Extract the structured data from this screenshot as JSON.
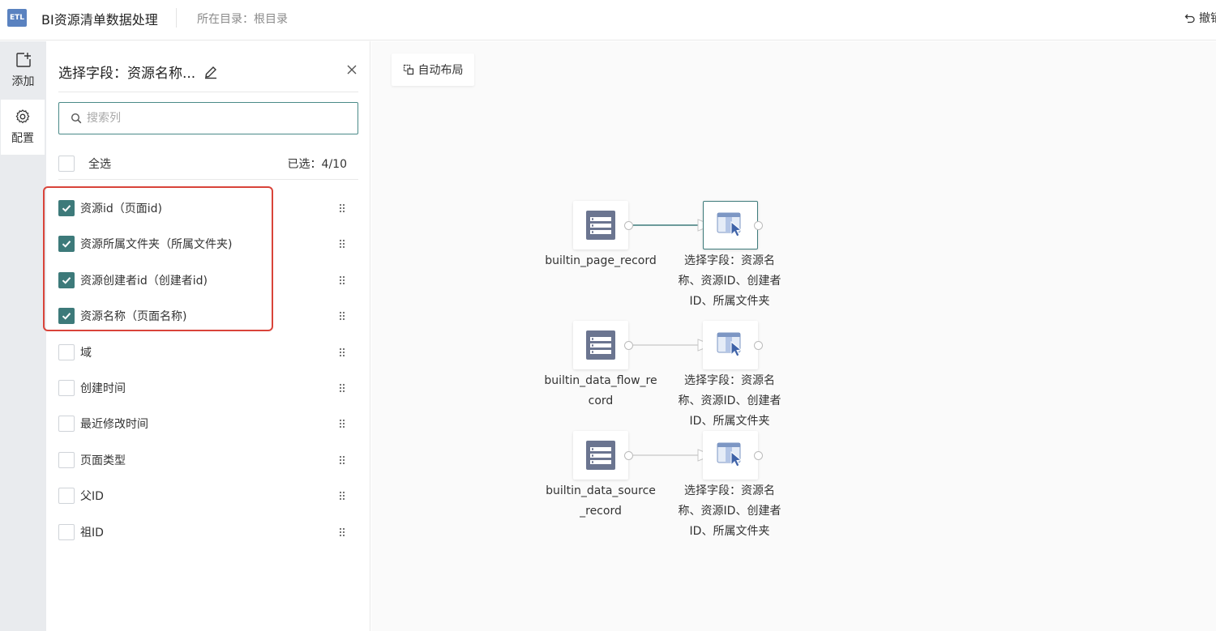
{
  "header": {
    "logo_text": "ETL",
    "title": "BI资源清单数据处理",
    "breadcrumb": "所在目录：根目录",
    "undo_label": "撤销"
  },
  "leftrail": {
    "items": [
      {
        "label": "添加",
        "icon": "add-node-icon"
      },
      {
        "label": "配置",
        "icon": "gear-icon"
      }
    ]
  },
  "panel": {
    "title": "选择字段：资源名称...",
    "search_placeholder": "搜索列",
    "select_all_label": "全选",
    "selected_count": "已选：4/10",
    "fields": [
      {
        "label": "资源id（页面id)",
        "checked": true
      },
      {
        "label": "资源所属文件夹（所属文件夹)",
        "checked": true
      },
      {
        "label": "资源创建者id（创建者id)",
        "checked": true
      },
      {
        "label": "资源名称（页面名称)",
        "checked": true
      },
      {
        "label": "域",
        "checked": false
      },
      {
        "label": "创建时间",
        "checked": false
      },
      {
        "label": "最近修改时间",
        "checked": false
      },
      {
        "label": "页面类型",
        "checked": false
      },
      {
        "label": "父ID",
        "checked": false
      },
      {
        "label": "祖ID",
        "checked": false
      }
    ]
  },
  "canvas": {
    "auto_layout_label": "自动布局",
    "flows": [
      {
        "source_label_1": "builtin_page_record",
        "source_label_2": "",
        "target_label_1": "选择字段：资源名",
        "target_label_2": "称、资源ID、创建者",
        "target_label_3": "ID、所属文件夹"
      },
      {
        "source_label_1": "builtin_data_flow_re",
        "source_label_2": "cord",
        "target_label_1": "选择字段：资源名",
        "target_label_2": "称、资源ID、创建者",
        "target_label_3": "ID、所属文件夹"
      },
      {
        "source_label_1": "builtin_data_source",
        "source_label_2": "_record",
        "target_label_1": "选择字段：资源名",
        "target_label_2": "称、资源ID、创建者",
        "target_label_3": "ID、所属文件夹"
      }
    ]
  },
  "colors": {
    "accent": "#3d7a7a",
    "highlight": "#d9443a",
    "node_icon": "#6b7590"
  }
}
